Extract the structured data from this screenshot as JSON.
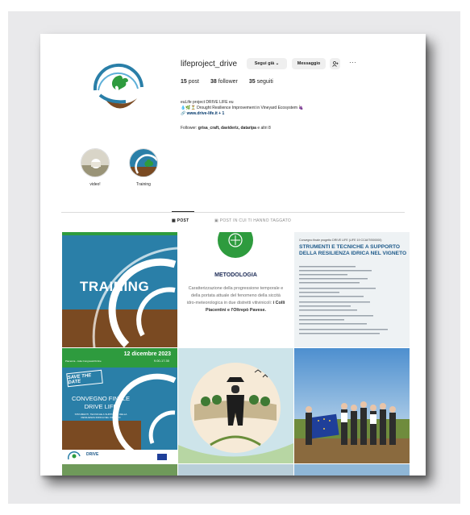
{
  "profile": {
    "username": "lifeproject_drive",
    "follow_button": "Segui già ⌄",
    "message_button": "Messaggio",
    "add_button": "+",
    "more_button": "···",
    "stats": {
      "posts": "15",
      "posts_label": "post",
      "followers": "38",
      "followers_label": "follower",
      "following": "35",
      "following_label": "seguiti"
    },
    "bio_line1": "euLife project DRIVE LIFE eu",
    "bio_line2": "💧🌿⏳ Drought Resilience Improvement in Vineyard Ecosystem 🍇",
    "bio_link": "www.drive-life.it",
    "bio_link_extra": " + 1",
    "followed_by_prefix": "Follower: ",
    "followed_by_names": "grisa_craft, davideriz, dataripa",
    "followed_by_suffix": " e altri 8"
  },
  "highlights": [
    {
      "label": "video!"
    },
    {
      "label": "Training"
    }
  ],
  "tabs": {
    "posts": "▦ POST",
    "tagged": "▣ POST IN CUI TI HANNO TAGGATO"
  },
  "posts": {
    "training_text": "TRAINING",
    "meto_title": "METODOLOGIA",
    "meto_body_1": "Caratterizzazione della progressione temporale e della portata attuale del fenomeno della siccità idro-meteorologica in due distretti vitivinicoli: ",
    "meto_body_bold": "i Colli Piacentini e l'Oltrepò Pavese.",
    "doc_small": "Convegno finale progetto DRIVE LIFE (LIFE 19 CCA/IT/000000)",
    "doc_title": "STRUMENTI E TECNICHE A SUPPORTO DELLA RESILIENZA IDRICA NEL VIGNETO",
    "conv_date": "12 dicembre 2023",
    "conv_time": "9.00-17.30",
    "conv_place": "Piacenza - Aula Congressi/Online",
    "save_the_date": "SAVE THE DATE",
    "conv_title": "CONVEGNO FINALE DRIVE LIFE",
    "conv_sub": "STRUMENTI, TECNICHE A SUPPORTO DELLA RESILIENZA IDRICA NEL VIGNETO",
    "drive_logo": "DRIVE"
  },
  "colors": {
    "accent_blue": "#2a7fa8",
    "brown": "#7a4a22",
    "green": "#2e9b3e",
    "link": "#00376b"
  }
}
